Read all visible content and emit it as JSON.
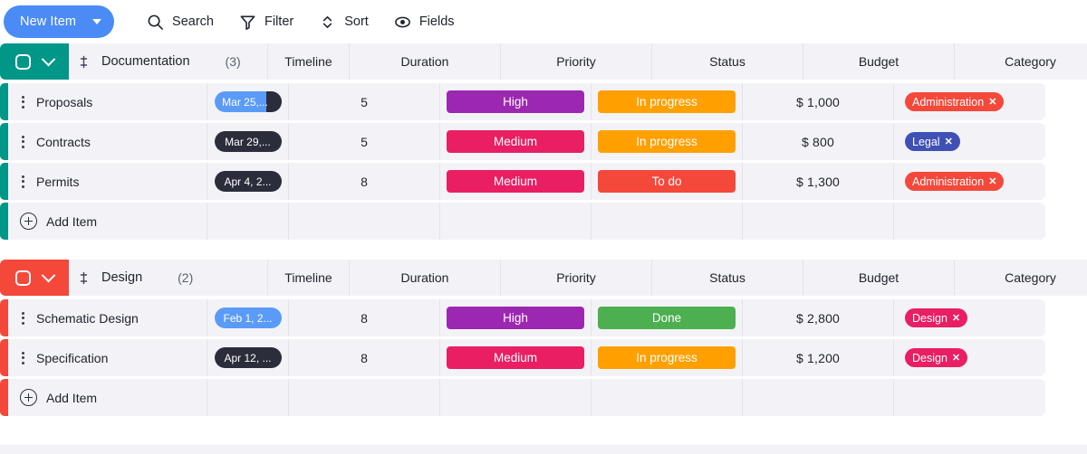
{
  "toolbar": {
    "new_item_label": "New Item",
    "items": [
      {
        "label": "Search",
        "icon": "search-icon"
      },
      {
        "label": "Filter",
        "icon": "filter-icon"
      },
      {
        "label": "Sort",
        "icon": "sort-icon"
      },
      {
        "label": "Fields",
        "icon": "eye-icon"
      }
    ]
  },
  "columns": [
    "Timeline",
    "Duration",
    "Priority",
    "Status",
    "Budget",
    "Category"
  ],
  "add_column_icon": "plus-circle-icon",
  "add_item_label": "Add Item",
  "colors": {
    "new_item_button": "#4a8bf5",
    "group_documentation": "#009688",
    "group_design": "#f4483a",
    "priority_high": "#9c27b0",
    "priority_medium": "#e91e63",
    "status_in_progress": "#ffa000",
    "status_to_do": "#f4483a",
    "status_done": "#4caf50",
    "tag_administration": "#f4483a",
    "tag_legal": "#3f51b5",
    "tag_design": "#e91e63",
    "timeline_blue": "#5b9bf8",
    "timeline_dark": "#2b2d3a",
    "cell_background": "#f3f3f7"
  },
  "groups": [
    {
      "name": "Documentation",
      "count": "(3)",
      "accent": "#009688",
      "rows": [
        {
          "name": "Proposals",
          "timeline": "Mar 25,...",
          "timeline_style": "blue",
          "duration": "5",
          "priority": "High",
          "priority_color": "#9c27b0",
          "status": "In progress",
          "status_color": "#ffa000",
          "budget": "$ 1,000",
          "category": "Administration",
          "category_color": "#f4483a"
        },
        {
          "name": "Contracts",
          "timeline": "Mar 29,...",
          "timeline_style": "dark",
          "duration": "5",
          "priority": "Medium",
          "priority_color": "#e91e63",
          "status": "In progress",
          "status_color": "#ffa000",
          "budget": "$ 800",
          "category": "Legal",
          "category_color": "#3f51b5"
        },
        {
          "name": "Permits",
          "timeline": "Apr 4, 2...",
          "timeline_style": "dark",
          "duration": "8",
          "priority": "Medium",
          "priority_color": "#e91e63",
          "status": "To do",
          "status_color": "#f4483a",
          "budget": "$ 1,300",
          "category": "Administration",
          "category_color": "#f4483a"
        }
      ]
    },
    {
      "name": "Design",
      "count": "(2)",
      "accent": "#f4483a",
      "rows": [
        {
          "name": "Schematic Design",
          "timeline": "Feb 1, 2...",
          "timeline_style": "blue-full",
          "duration": "8",
          "priority": "High",
          "priority_color": "#9c27b0",
          "status": "Done",
          "status_color": "#4caf50",
          "budget": "$ 2,800",
          "category": "Design",
          "category_color": "#e91e63"
        },
        {
          "name": "Specification",
          "timeline": "Apr 12, ...",
          "timeline_style": "dark",
          "duration": "8",
          "priority": "Medium",
          "priority_color": "#e91e63",
          "status": "In progress",
          "status_color": "#ffa000",
          "budget": "$ 1,200",
          "category": "Design",
          "category_color": "#e91e63"
        }
      ]
    }
  ]
}
